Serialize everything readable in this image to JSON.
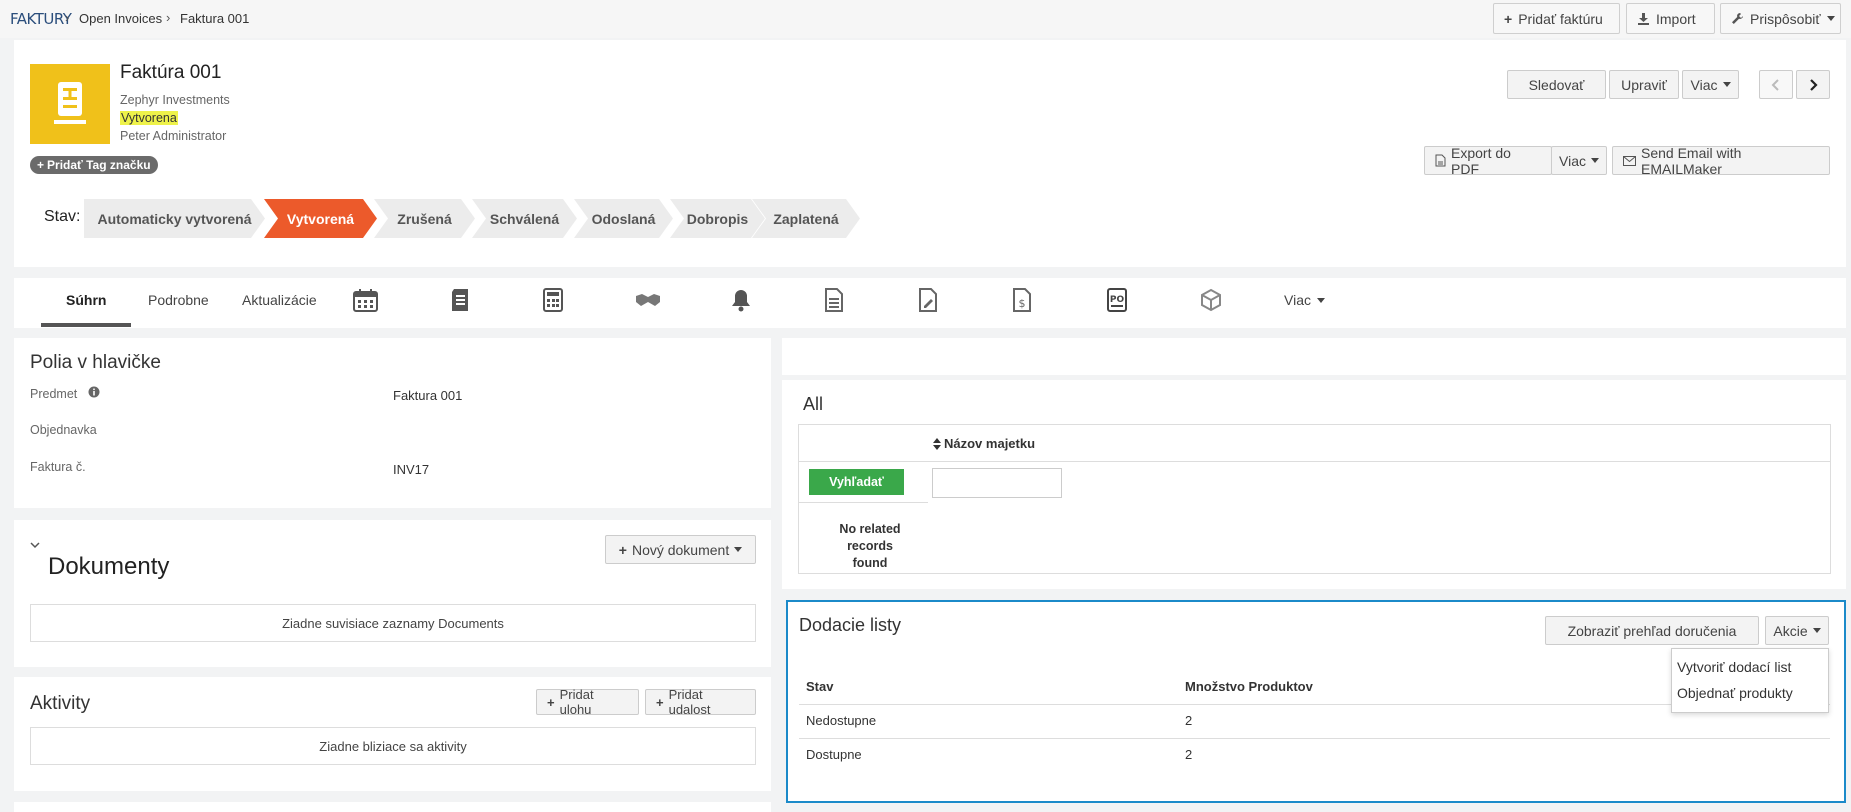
{
  "breadcrumb": {
    "module": "FAKTURY",
    "list": "Open Invoices",
    "current": "Faktura 001"
  },
  "top_actions": {
    "add": "Pridať faktúru",
    "import": "Import",
    "customize": "Prispôsobiť"
  },
  "record": {
    "title": "Faktúra 001",
    "account": "Zephyr Investments",
    "status": "Vytvorena",
    "owner": "Peter Administrator",
    "add_tag": "Pridať Tag značku"
  },
  "record_actions": {
    "follow": "Sledovať",
    "edit": "Upraviť",
    "more": "Viac",
    "export_pdf": "Export do PDF",
    "more2": "Viac",
    "send_email": "Send Email with EMAILMaker"
  },
  "stages": {
    "label": "Stav:",
    "items": [
      "Automaticky vytvorená",
      "Vytvorená",
      "Zrušená",
      "Schválená",
      "Odoslaná",
      "Dobropis",
      "Zaplatená"
    ],
    "active_index": 1
  },
  "tabs": {
    "items": [
      "Súhrn",
      "Podrobne",
      "Aktualizácie"
    ],
    "active_index": 0,
    "icons": [
      "calendar-icon",
      "document-list-icon",
      "calculator-icon",
      "handshake-icon",
      "bell-icon",
      "invoice-icon",
      "edit-document-icon",
      "dollar-document-icon",
      "po-document-icon",
      "package-icon"
    ],
    "more": "Viac"
  },
  "header_fields": {
    "title": "Polia v hlavičke",
    "rows": [
      {
        "label": "Predmet",
        "value": "Faktura 001"
      },
      {
        "label": "Objednavka",
        "value": ""
      },
      {
        "label": "Faktura č.",
        "value": "INV17"
      }
    ]
  },
  "documents": {
    "title": "Dokumenty",
    "new_button": "Nový dokument",
    "empty": "Ziadne suvisiace zaznamy Documents"
  },
  "activities": {
    "title": "Aktivity",
    "add_task": "Pridat ulohu",
    "add_event": "Pridat udalost",
    "empty": "Ziadne bliziace sa aktivity"
  },
  "assets": {
    "title": "All",
    "column": "Názov majetku",
    "search_button": "Vyhľadať",
    "search_placeholder": "",
    "empty_line1": "No related",
    "empty_line2": "records found"
  },
  "delivery": {
    "title": "Dodacie listy",
    "overview_button": "Zobraziť prehľad doručenia",
    "actions_button": "Akcie",
    "columns": [
      "Stav",
      "Množstvo Produktov"
    ],
    "rows": [
      {
        "stav": "Nedostupne",
        "qty": "2"
      },
      {
        "stav": "Dostupne",
        "qty": "2"
      }
    ],
    "menu": [
      "Vytvoriť dodací list",
      "Objednať produkty"
    ]
  },
  "colors": {
    "accent_orange": "#ec5a2b",
    "logo_yellow": "#f0c11a",
    "search_green": "#3aa84a",
    "focus_blue": "#1b8ac9"
  }
}
